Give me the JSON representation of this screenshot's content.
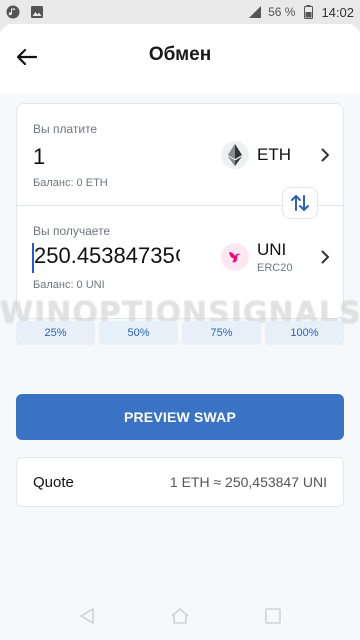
{
  "statusbar": {
    "battery": "56 %",
    "time": "14:02",
    "network": "4G"
  },
  "header": {
    "title": "Обмен"
  },
  "pay": {
    "label": "Вы платите",
    "amount": "1",
    "balance": "Баланс: 0 ETH",
    "token": "ETH"
  },
  "receive": {
    "label": "Вы получаете",
    "amount": "250.45384735¢",
    "balance": "Баланс: 0 UNI",
    "token": "UNI",
    "network": "ERC20"
  },
  "percent_buttons": [
    "25%",
    "50%",
    "75%",
    "100%"
  ],
  "preview_label": "PREVIEW SWAP",
  "quote": {
    "label": "Quote",
    "value": "1 ETH ≈ 250,453847 UNI"
  },
  "watermark": "WINOPTIONSIGNALS.COM",
  "colors": {
    "primary": "#3a73c4",
    "accent_bg": "#e7eff9",
    "uni_pink": "#ff007a"
  }
}
